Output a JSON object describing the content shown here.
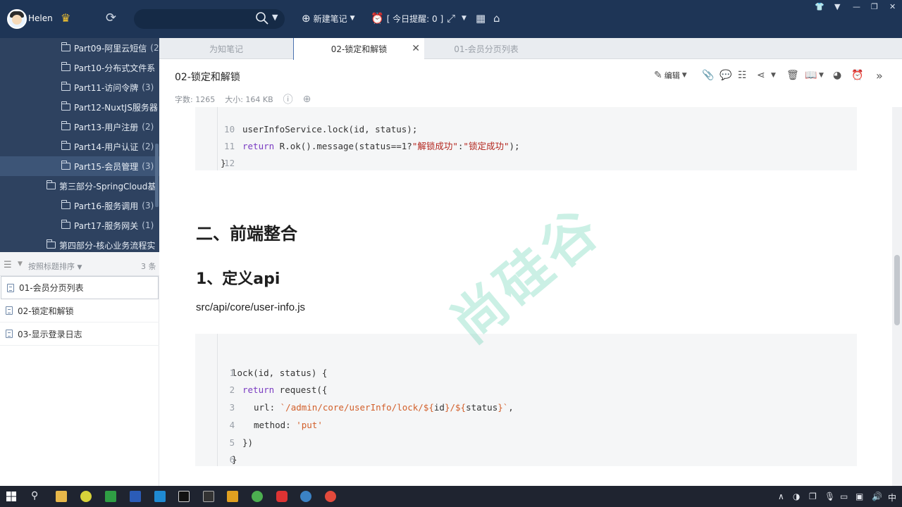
{
  "app": {
    "user_name": "Helen",
    "search_placeholder": "",
    "new_note_label": "新建笔记",
    "reminder_label": "[ 今日提醒: 0 ]"
  },
  "tree": [
    {
      "label": "Part09-阿里云短信",
      "count": "(2"
    },
    {
      "label": "Part10-分布式文件系",
      "count": ""
    },
    {
      "label": "Part11-访问令牌",
      "count": "(3)"
    },
    {
      "label": "Part12-NuxtJS服务器",
      "count": ""
    },
    {
      "label": "Part13-用户注册",
      "count": "(2)"
    },
    {
      "label": "Part14-用户认证",
      "count": "(2)"
    },
    {
      "label": "Part15-会员管理",
      "count": "(3)"
    },
    {
      "label": "第三部分-SpringCloud基",
      "count": ""
    },
    {
      "label": "Part16-服务调用",
      "count": "(3)"
    },
    {
      "label": "Part17-服务网关",
      "count": "(1)"
    },
    {
      "label": "第四部分-核心业务流程实",
      "count": ""
    }
  ],
  "sort": {
    "label": "按照标题排序",
    "count": "3 条"
  },
  "notes": [
    "01-会员分页列表",
    "02-锁定和解锁",
    "03-显示登录日志"
  ],
  "tabs": [
    "为知笔记",
    "02-锁定和解锁",
    "01-会员分页列表"
  ],
  "note": {
    "title": "02-锁定和解锁",
    "word_count": "字数: 1265",
    "size": "大小: 164 KB",
    "edit_label": "编辑"
  },
  "code1": {
    "lines": [
      {
        "n": "10",
        "plain": "userInfoService.lock(id, status);"
      },
      {
        "n": "11",
        "kw": "return",
        "pre": " R.ok().message(status==1?",
        "s1": "\"解锁成功\"",
        "mid": ":",
        "s2": "\"锁定成功\"",
        "post": ");"
      },
      {
        "n": "12",
        "plain": "}"
      }
    ]
  },
  "heading2": "二、前端整合",
  "heading3": "1、定义api",
  "path_text": "src/api/core/user-info.js",
  "code2": {
    "line_numbers": [
      "1",
      "2",
      "3",
      "4",
      "5",
      "6"
    ],
    "l1": "lock(id, status) {",
    "l2_kw": "return",
    "l2": " request({",
    "l3_key": "url: ",
    "l3_a": "`/admin/core/userInfo/lock/${",
    "l3_b": "id",
    "l3_c": "}/${",
    "l3_d": "status",
    "l3_e": "}`",
    "l3_f": ",",
    "l4_key": "method: ",
    "l4_val": "'put'",
    "l5": "})",
    "l6": "}"
  },
  "watermark": "尚硅谷",
  "ime": "中"
}
